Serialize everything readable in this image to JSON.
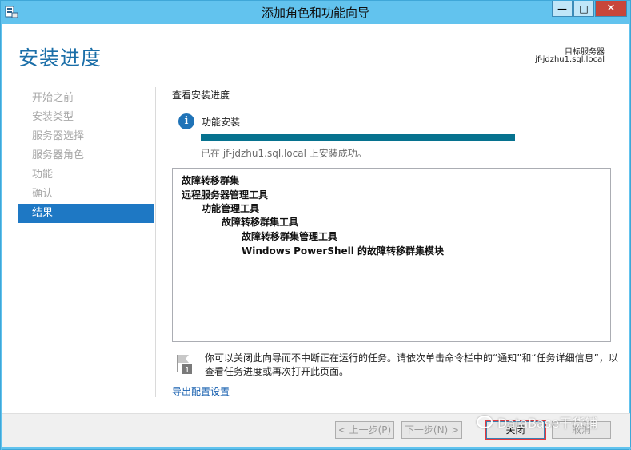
{
  "window": {
    "title": "添加角色和功能向导",
    "controls": {
      "minimize": "—",
      "maximize": "□",
      "close": "✕"
    }
  },
  "page": {
    "title": "安装进度",
    "target_label": "目标服务器",
    "target_value": "jf-jdzhu1.sql.local"
  },
  "nav": {
    "items": [
      {
        "label": "开始之前",
        "active": false
      },
      {
        "label": "安装类型",
        "active": false
      },
      {
        "label": "服务器选择",
        "active": false
      },
      {
        "label": "服务器角色",
        "active": false
      },
      {
        "label": "功能",
        "active": false
      },
      {
        "label": "确认",
        "active": false
      },
      {
        "label": "结果",
        "active": true
      }
    ]
  },
  "content": {
    "section_header": "查看安装进度",
    "install_label": "功能安装",
    "progress_fraction": 1.0,
    "status_text": "已在 jf-jdzhu1.sql.local 上安装成功。",
    "results": [
      {
        "text": "故障转移群集",
        "level": 0
      },
      {
        "text": "远程服务器管理工具",
        "level": 0
      },
      {
        "text": "功能管理工具",
        "level": 1
      },
      {
        "text": "故障转移群集工具",
        "level": 2
      },
      {
        "text": "故障转移群集管理工具",
        "level": 3
      },
      {
        "text": "Windows PowerShell 的故障转移群集模块",
        "level": 3
      }
    ],
    "note_line1": "你可以关闭此向导而不中断正在运行的任务。请依次单击命令栏中的“通知”和“任务详细信息”，以",
    "note_line2": "查看任务进度或再次打开此页面。",
    "flag_badge": "1",
    "export_link": "导出配置设置"
  },
  "buttons": {
    "prev": "< 上一步(P)",
    "next": "下一步(N) >",
    "close": "关闭",
    "cancel": "取消"
  },
  "watermark": {
    "text": "DataBase干货铺"
  },
  "colors": {
    "titlebar": "#62c3ee",
    "accent": "#1e78c4",
    "progress": "#06728f",
    "link": "#1a62b0"
  }
}
